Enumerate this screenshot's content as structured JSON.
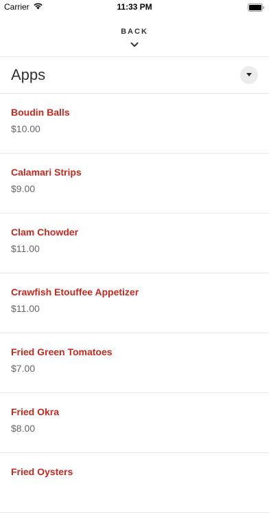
{
  "status_bar": {
    "carrier": "Carrier",
    "time": "11:33 PM",
    "icons": [
      "wifi-icon",
      "battery-icon"
    ]
  },
  "header": {
    "back_label": "BACK",
    "back_icon": "chevron-down-icon"
  },
  "section": {
    "title": "Apps",
    "dropdown_icon": "caret-down-icon"
  },
  "colors": {
    "item_name": "#c8281e",
    "price": "#666666",
    "divider": "#e6e6e6"
  },
  "items": [
    {
      "name": "Boudin Balls",
      "price": "$10.00"
    },
    {
      "name": "Calamari Strips",
      "price": "$9.00"
    },
    {
      "name": "Clam Chowder",
      "price": "$11.00"
    },
    {
      "name": "Crawfish Etouffee Appetizer",
      "price": "$11.00"
    },
    {
      "name": "Fried Green Tomatoes",
      "price": "$7.00"
    },
    {
      "name": "Fried Okra",
      "price": "$8.00"
    },
    {
      "name": "Fried Oysters",
      "price": ""
    }
  ]
}
